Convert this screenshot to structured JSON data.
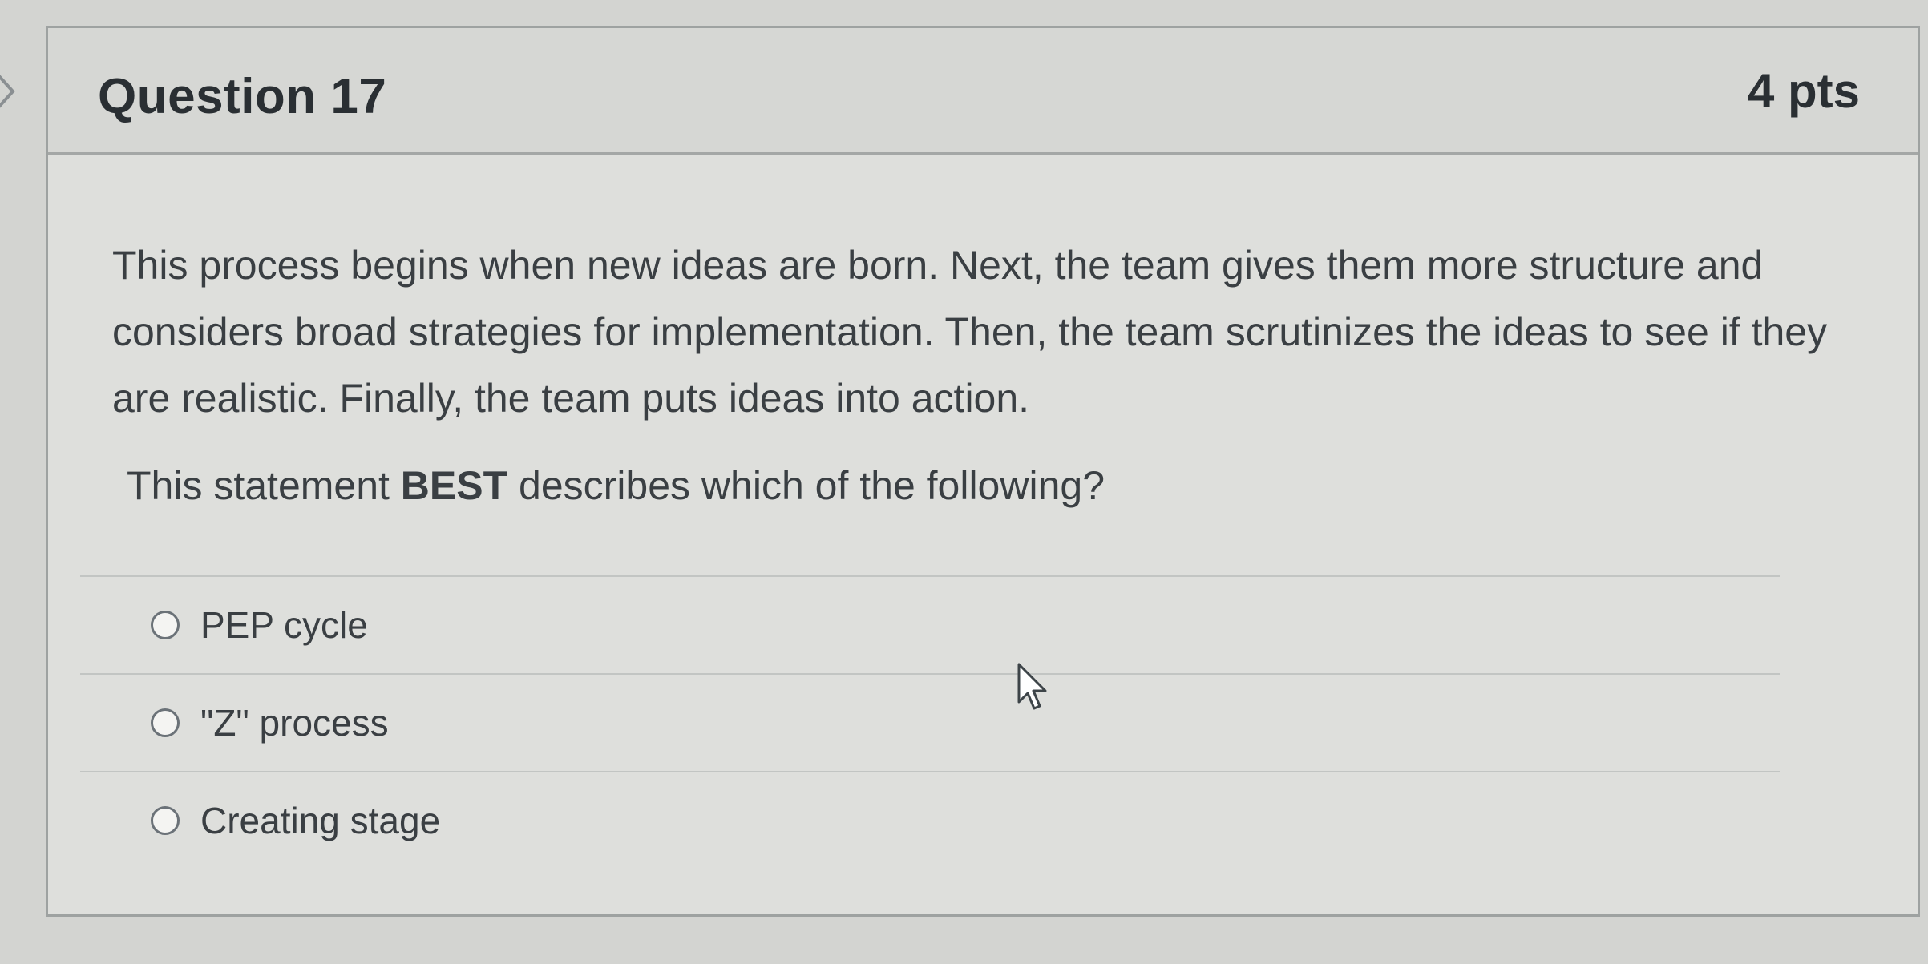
{
  "question": {
    "title": "Question 17",
    "points": "4 pts",
    "text": "This process begins when new ideas are born. Next, the team gives them more structure and considers broad strategies for implementation. Then, the team scrutinizes the ideas to see if they are realistic. Finally, the team puts ideas into action.",
    "prompt_before": "This statement ",
    "prompt_bold": "BEST",
    "prompt_after": " describes which of the following?",
    "answers": [
      {
        "label": "PEP cycle",
        "selected": false
      },
      {
        "label": "\"Z\" process",
        "selected": false
      },
      {
        "label": "Creating stage",
        "selected": false
      }
    ]
  },
  "icons": {
    "nav": "chevron-right-icon",
    "pointer": "mouse-cursor-icon"
  }
}
